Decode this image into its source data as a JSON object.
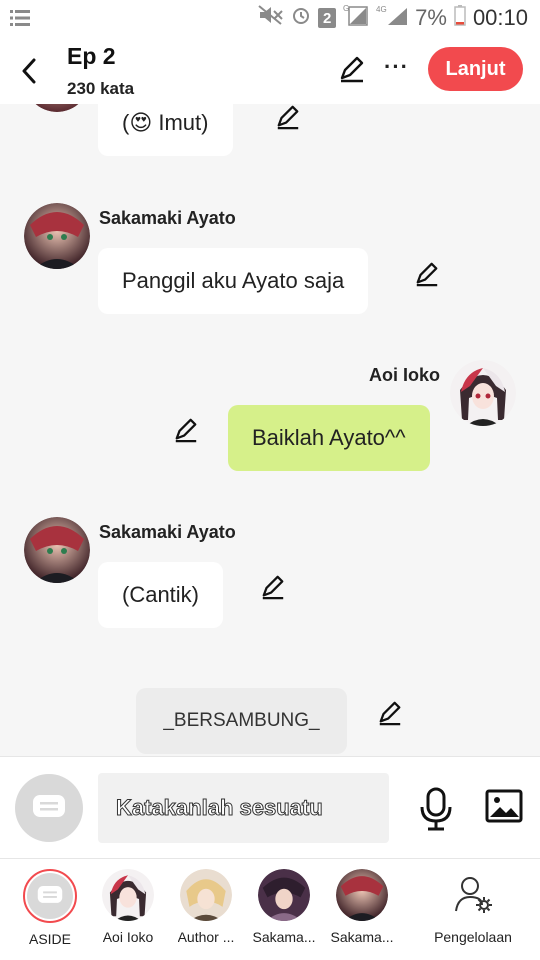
{
  "status_bar": {
    "battery": "7%",
    "time": "00:10",
    "notification_count": "2"
  },
  "header": {
    "title": "Ep 2",
    "word_count": "230 kata",
    "next_label": "Lanjut",
    "more_label": "···"
  },
  "colors": {
    "accent": "#f24a4e",
    "bubble_self": "#d6f08a",
    "bubble_other": "#ffffff",
    "bubble_aside": "#ececec"
  },
  "messages": [
    {
      "side": "left",
      "text": "(😍 Imut)"
    },
    {
      "side": "left",
      "name": "Sakamaki Ayato",
      "text": "Panggil aku Ayato saja"
    },
    {
      "side": "right",
      "name": "Aoi Ioko",
      "text": "Baiklah Ayato^^"
    },
    {
      "side": "left",
      "name": "Sakamaki Ayato",
      "text": "(Cantik)"
    },
    {
      "side": "center",
      "text": "_BERSAMBUNG_"
    }
  ],
  "composer": {
    "placeholder": "Katakanlah sesuatu"
  },
  "tabs": [
    {
      "label": "ASIDE",
      "icon": "chat-bubble-icon"
    },
    {
      "label": "Aoi Ioko"
    },
    {
      "label": "Author ..."
    },
    {
      "label": "Sakama..."
    },
    {
      "label": "Sakama..."
    },
    {
      "label": "Pengelolaan",
      "icon": "user-settings-icon"
    }
  ]
}
